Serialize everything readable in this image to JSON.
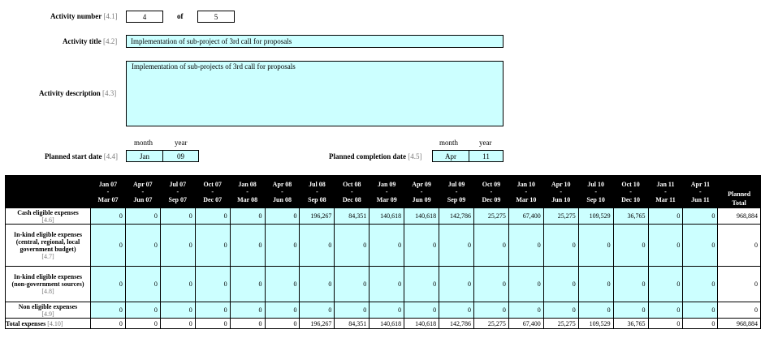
{
  "activity": {
    "number_label": "Activity number",
    "number_ref": "[4.1]",
    "number_value": "4",
    "of_label": "of",
    "total_value": "5",
    "title_label": "Activity title",
    "title_ref": "[4.2]",
    "title_value": "Implementation of sub-project of 3rd call for proposals",
    "description_label": "Activity description",
    "description_ref": "[4.3]",
    "description_value": "Implementation of sub-projects of 3rd call for proposals"
  },
  "dates": {
    "month_label": "month",
    "year_label": "year",
    "start_label": "Planned start date",
    "start_ref": "[4.4]",
    "start_month": "Jan",
    "start_year": "09",
    "completion_label": "Planned completion date",
    "completion_ref": "[4.5]",
    "completion_month": "Apr",
    "completion_year": "11"
  },
  "table": {
    "periods": [
      {
        "top": "Jan 07",
        "bottom": "Mar 07"
      },
      {
        "top": "Apr 07",
        "bottom": "Jun 07"
      },
      {
        "top": "Jul 07",
        "bottom": "Sep 07"
      },
      {
        "top": "Oct 07",
        "bottom": "Dec 07"
      },
      {
        "top": "Jan 08",
        "bottom": "Mar 08"
      },
      {
        "top": "Apr 08",
        "bottom": "Jun 08"
      },
      {
        "top": "Jul 08",
        "bottom": "Sep 08"
      },
      {
        "top": "Oct 08",
        "bottom": "Dec 08"
      },
      {
        "top": "Jan 09",
        "bottom": "Mar 09"
      },
      {
        "top": "Apr 09",
        "bottom": "Jun 09"
      },
      {
        "top": "Jul 09",
        "bottom": "Sep 09"
      },
      {
        "top": "Oct 09",
        "bottom": "Dec 09"
      },
      {
        "top": "Jan 10",
        "bottom": "Mar 10"
      },
      {
        "top": "Apr 10",
        "bottom": "Jun 10"
      },
      {
        "top": "Jul 10",
        "bottom": "Sep 10"
      },
      {
        "top": "Oct 10",
        "bottom": "Dec 10"
      },
      {
        "top": "Jan 11",
        "bottom": "Mar 11"
      },
      {
        "top": "Apr 11",
        "bottom": "Jun 11"
      }
    ],
    "dash": "-",
    "planned_total_label_1": "Planned",
    "planned_total_label_2": "Total",
    "rows": [
      {
        "label": "Cash eligible expenses",
        "ref": "[4.6]",
        "values": [
          "0",
          "0",
          "0",
          "0",
          "0",
          "0",
          "196,267",
          "84,351",
          "140,618",
          "140,618",
          "142,786",
          "25,275",
          "67,400",
          "25,275",
          "109,529",
          "36,765",
          "0",
          "0"
        ],
        "total": "968,884"
      },
      {
        "label": "In-kind eligible expenses (central, regional, local government budget)",
        "ref": "[4.7]",
        "values": [
          "0",
          "0",
          "0",
          "0",
          "0",
          "0",
          "0",
          "0",
          "0",
          "0",
          "0",
          "0",
          "0",
          "0",
          "0",
          "0",
          "0",
          "0"
        ],
        "total": "0"
      },
      {
        "label": "In-kind eligible expenses (non-government sources)",
        "ref": "[4.8]",
        "values": [
          "0",
          "0",
          "0",
          "0",
          "0",
          "0",
          "0",
          "0",
          "0",
          "0",
          "0",
          "0",
          "0",
          "0",
          "0",
          "0",
          "0",
          "0"
        ],
        "total": "0"
      },
      {
        "label": "Non eligible expenses",
        "ref": "[4.9]",
        "values": [
          "0",
          "0",
          "0",
          "0",
          "0",
          "0",
          "0",
          "0",
          "0",
          "0",
          "0",
          "0",
          "0",
          "0",
          "0",
          "0",
          "0",
          "0"
        ],
        "total": "0"
      }
    ],
    "total_row": {
      "label": "Total expenses",
      "ref": "[4.10]",
      "values": [
        "0",
        "0",
        "0",
        "0",
        "0",
        "0",
        "196,267",
        "84,351",
        "140,618",
        "140,618",
        "142,786",
        "25,275",
        "67,400",
        "25,275",
        "109,529",
        "36,765",
        "0",
        "0"
      ],
      "total": "968,884"
    }
  },
  "colors": {
    "input_fill": "#ccffff",
    "header_fill": "#000000",
    "ref_text": "#7a7a7a"
  }
}
